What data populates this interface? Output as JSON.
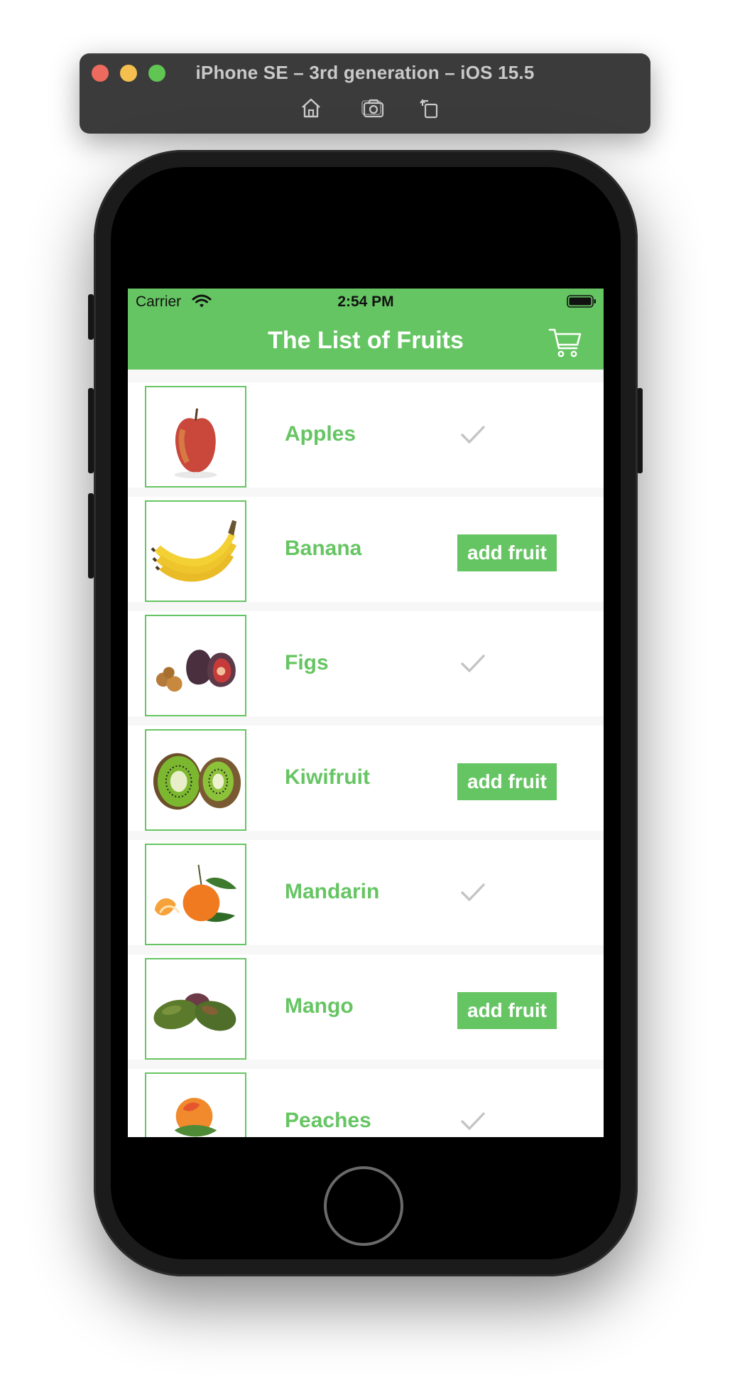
{
  "simulator": {
    "title": "iPhone SE – 3rd generation – iOS 15.5",
    "tools": [
      {
        "name": "home-icon"
      },
      {
        "name": "screenshot-icon"
      },
      {
        "name": "rotate-icon"
      }
    ]
  },
  "status_bar": {
    "carrier": "Carrier",
    "time": "2:54 PM",
    "icons": [
      "wifi-icon",
      "battery-icon"
    ]
  },
  "nav": {
    "title": "The List of Fruits",
    "cart_icon": "cart-icon"
  },
  "fruits": [
    {
      "name": "Apples",
      "state": "added",
      "image": "apple"
    },
    {
      "name": "Banana",
      "state": "available",
      "action_label": "add fruit",
      "image": "banana"
    },
    {
      "name": "Figs",
      "state": "added",
      "image": "figs"
    },
    {
      "name": "Kiwifruit",
      "state": "available",
      "action_label": "add fruit",
      "image": "kiwi"
    },
    {
      "name": "Mandarin",
      "state": "added",
      "image": "mandarin"
    },
    {
      "name": "Mango",
      "state": "available",
      "action_label": "add fruit",
      "image": "mango"
    },
    {
      "name": "Peaches",
      "state": "added",
      "image": "peach"
    }
  ],
  "colors": {
    "accent": "#66c563",
    "check": "#c4c4c4",
    "list_background": "#f7f7f7"
  }
}
